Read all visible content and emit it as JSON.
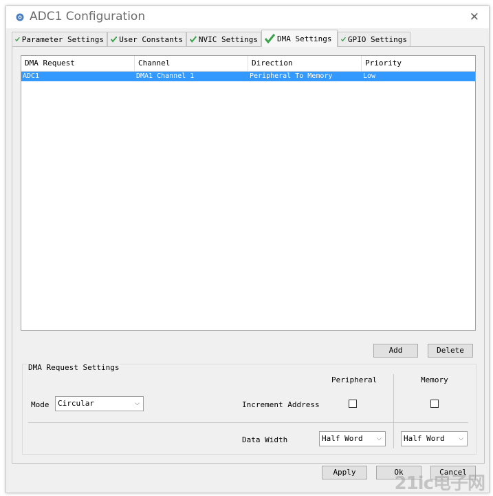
{
  "window": {
    "title": "ADC1 Configuration",
    "close_glyph": "✕"
  },
  "tabs": [
    {
      "label": "Parameter Settings",
      "icon": "checkmark-icon"
    },
    {
      "label": "User Constants",
      "icon": "checkmark-icon"
    },
    {
      "label": "NVIC Settings",
      "icon": "checkmark-icon"
    },
    {
      "label": "DMA Settings",
      "icon": "checkmark-icon",
      "active": true
    },
    {
      "label": "GPIO Settings",
      "icon": "checkmark-icon"
    }
  ],
  "table": {
    "columns": [
      "DMA Request",
      "Channel",
      "Direction",
      "Priority"
    ],
    "rows": [
      [
        "ADC1",
        "DMA1 Channel 1",
        "Peripheral To Memory",
        "Low"
      ]
    ]
  },
  "buttons": {
    "add": "Add",
    "delete": "Delete",
    "apply": "Apply",
    "ok": "Ok",
    "cancel": "Cancel"
  },
  "settings": {
    "title": "DMA Request Settings",
    "peripheral_header": "Peripheral",
    "memory_header": "Memory",
    "mode_label": "Mode",
    "mode_value": "Circular",
    "increment_label": "Increment Address",
    "data_width_label": "Data Width",
    "peripheral_width": "Half Word",
    "memory_width": "Half Word"
  },
  "watermark": "21ic电子网",
  "colors": {
    "selection": "#3399ff",
    "check": "#3aa04a"
  }
}
